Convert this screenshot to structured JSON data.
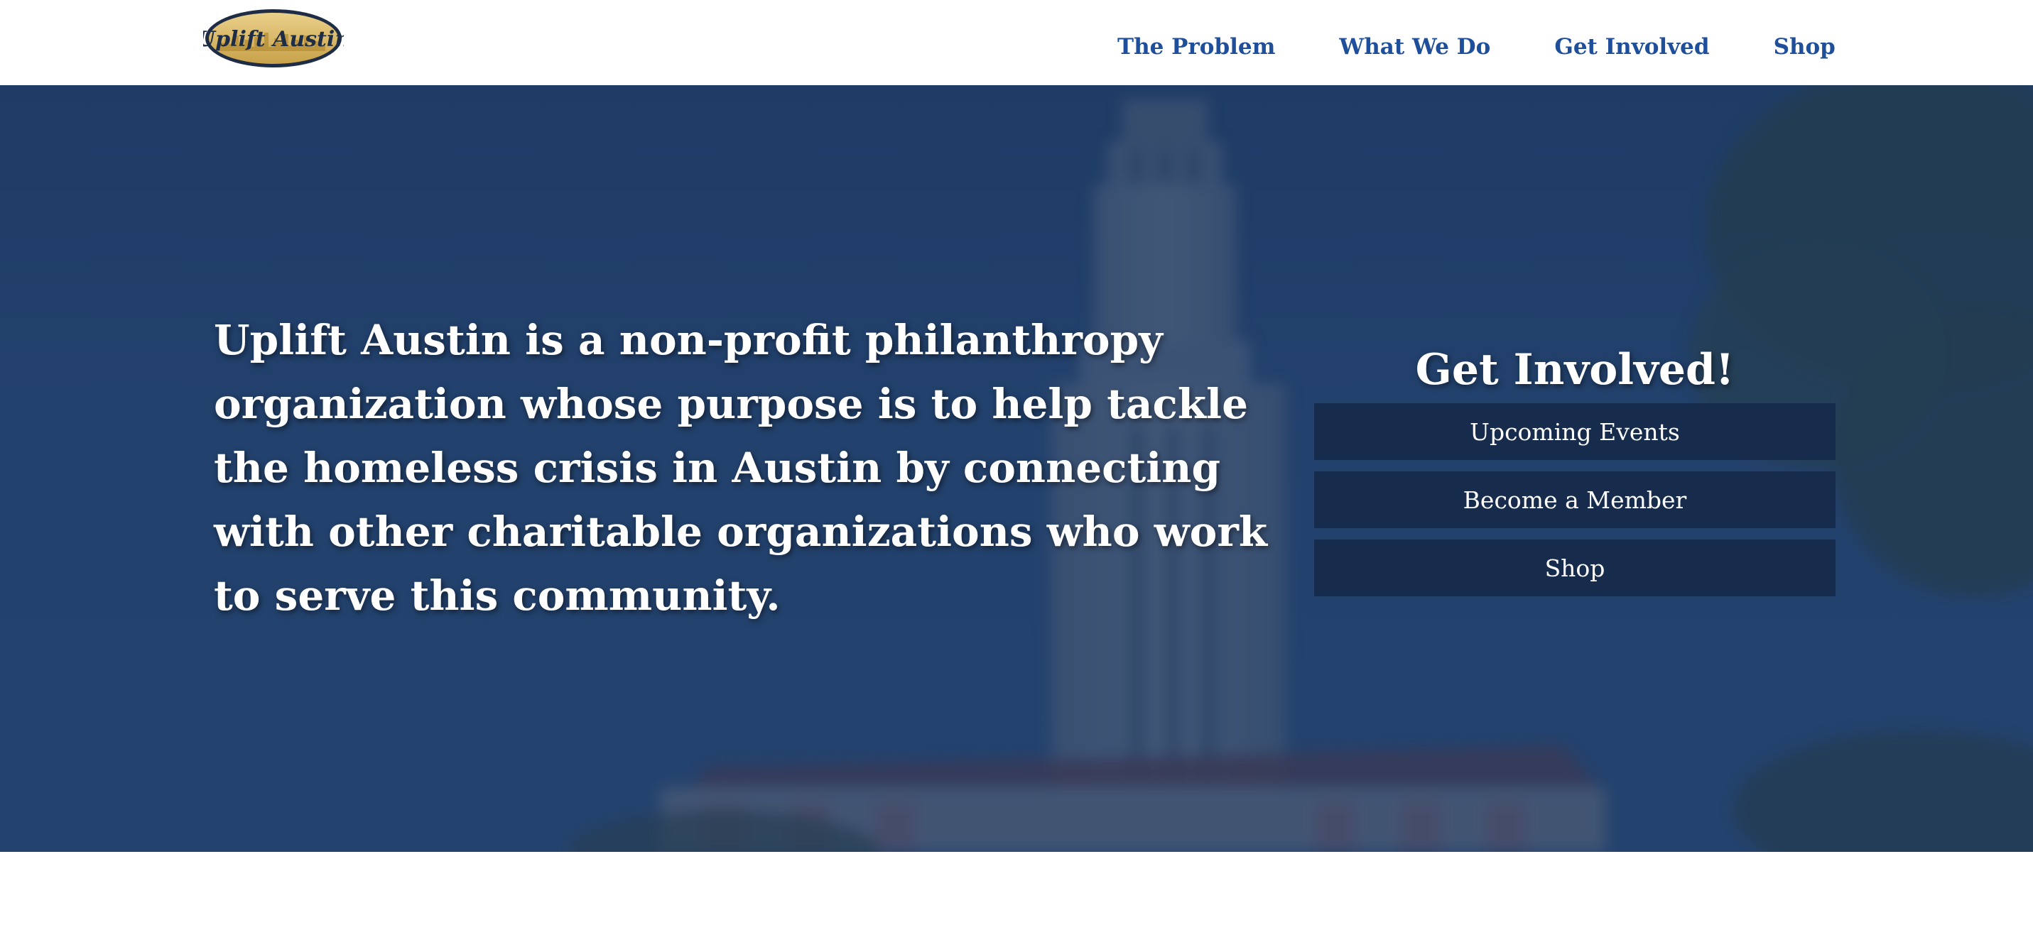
{
  "brand": {
    "logo_text": "Uplift Austin",
    "colors": {
      "gold": "#dcbd63",
      "navy": "#1e2d45",
      "nav_link": "#1f4e9a",
      "button_bg": "#172c4d"
    }
  },
  "nav": {
    "items": [
      {
        "label": "The Problem"
      },
      {
        "label": "What We Do"
      },
      {
        "label": "Get Involved"
      },
      {
        "label": "Shop"
      }
    ]
  },
  "hero": {
    "background": "blurred photo of UT Tower with blue sky, dark blue overlay",
    "mission_text": "Uplift Austin is a non-profit philanthropy organization whose purpose is to help tackle the homeless crisis in Austin by connecting with other charitable organizations who work to serve this community.",
    "cta": {
      "title": "Get Involved!",
      "buttons": [
        {
          "label": "Upcoming Events"
        },
        {
          "label": "Become a Member"
        },
        {
          "label": "Shop"
        }
      ]
    }
  }
}
